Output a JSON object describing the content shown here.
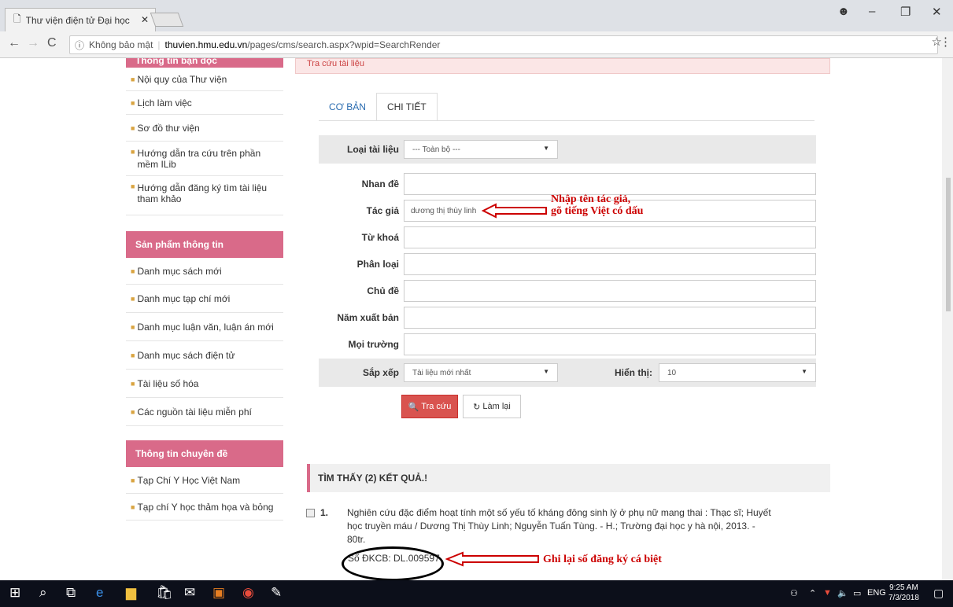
{
  "browser": {
    "tab_title": "Thư viện điện tử Đại học",
    "security_label": "Không bảo mật",
    "url_host": "thuvien.hmu.edu.vn",
    "url_path": "/pages/cms/search.aspx?wpid=SearchRender"
  },
  "sidebar": {
    "section1_title": "Thông tin bạn đọc",
    "items1": [
      "Nội quy của Thư viện",
      "Lịch làm việc",
      "Sơ đồ thư viện",
      "Hướng dẫn tra cứu trên phần mềm ILib",
      "Hướng dẫn đăng ký tìm tài liệu tham khảo"
    ],
    "section2_title": "Sản phẩm thông tin",
    "items2": [
      "Danh mục sách mới",
      "Danh mục tạp chí mới",
      "Danh mục luận văn, luận án mới",
      "Danh mục sách điện tử",
      "Tài liệu số hóa",
      "Các nguồn tài liệu miễn phí"
    ],
    "section3_title": "Thông tin chuyên đề",
    "items3": [
      "Tạp Chí Y Học Việt Nam",
      "Tạp chí Y học thảm họa và bỏng"
    ]
  },
  "search": {
    "header": "Tra cứu tài liệu",
    "tab_basic": "CƠ BẢN",
    "tab_detail": "CHI TIẾT",
    "doc_type_label": "Loại tài liệu",
    "doc_type_value": "--- Toàn bộ ---",
    "title_label": "Nhan đề",
    "author_label": "Tác giả",
    "author_value": "dương thị thùy linh",
    "keyword_label": "Từ khoá",
    "class_label": "Phân loại",
    "subject_label": "Chủ đề",
    "year_label": "Năm xuất bản",
    "all_label": "Mọi trường",
    "sort_label": "Sắp xếp",
    "sort_value": "Tài liệu mới nhất",
    "show_label": "Hiển thị:",
    "show_value": "10",
    "search_btn": "Tra cứu",
    "reset_btn": "Làm lại"
  },
  "results": {
    "header": "TÌM THẤY (2) KẾT QUẢ.!",
    "item_number": "1.",
    "item_line1": "Nghiên cứu đặc điểm hoạt tính một số yếu tố kháng đông sinh lý ở phụ nữ mang thai : Thạc sĩ; Huyết",
    "item_line2": "học truyền máu / Dương Thị Thùy Linh; Nguyễn Tuấn Tùng. - H.; Trường đại học y hà nội, 2013. -",
    "item_line3": "80tr.",
    "dkcb_label": "Số ĐKCB:",
    "dkcb_value": "DL.009597"
  },
  "annotations": {
    "author_note_line1": "Nhập tên tác giả,",
    "author_note_line2": "gõ tiếng Việt có dấu",
    "dkcb_note": "Ghi lại số đăng ký cá biệt"
  },
  "taskbar": {
    "lang": "ENG",
    "time": "9:25 AM",
    "date": "7/3/2018"
  },
  "colors": {
    "sidebar_header": "#d96a89",
    "search_button": "#d9534f",
    "annotation": "#cc0000"
  }
}
